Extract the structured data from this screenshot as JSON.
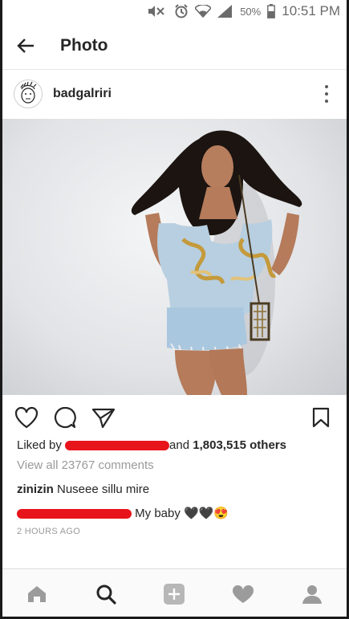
{
  "status_bar": {
    "battery_percent": "50%",
    "time": "10:51 PM",
    "icons": [
      "mute-icon",
      "alarm-icon",
      "wifi-icon",
      "signal-icon",
      "battery-icon"
    ]
  },
  "header": {
    "title": "Photo",
    "back_icon": "arrow-left-icon"
  },
  "post": {
    "username": "badgalriri",
    "more_icon": "more-vertical-icon",
    "photo_alt": "photo",
    "actions": {
      "like_icon": "heart-outline-icon",
      "comment_icon": "comment-bubble-icon",
      "share_icon": "send-icon",
      "save_icon": "bookmark-icon"
    },
    "likes": {
      "prefix": "Liked by",
      "middle": "and",
      "count_text": "1,803,515 others"
    },
    "view_all_comments": "View all 23767 comments",
    "comments": [
      {
        "user": "zinizin",
        "text": "Nuseee sillu mire"
      },
      {
        "user": "",
        "text": "My baby",
        "emoji": "🖤🖤😍"
      }
    ],
    "time_ago": "2 HOURS AGO"
  },
  "tab_bar": {
    "tabs": [
      {
        "name": "home",
        "icon": "home-icon"
      },
      {
        "name": "search",
        "icon": "search-icon"
      },
      {
        "name": "add",
        "icon": "plus-square-icon"
      },
      {
        "name": "activity",
        "icon": "heart-icon"
      },
      {
        "name": "profile",
        "icon": "person-icon"
      }
    ]
  },
  "colors": {
    "redaction": "#e8141b",
    "text_primary": "#262626",
    "text_secondary": "#9a9a9a"
  }
}
